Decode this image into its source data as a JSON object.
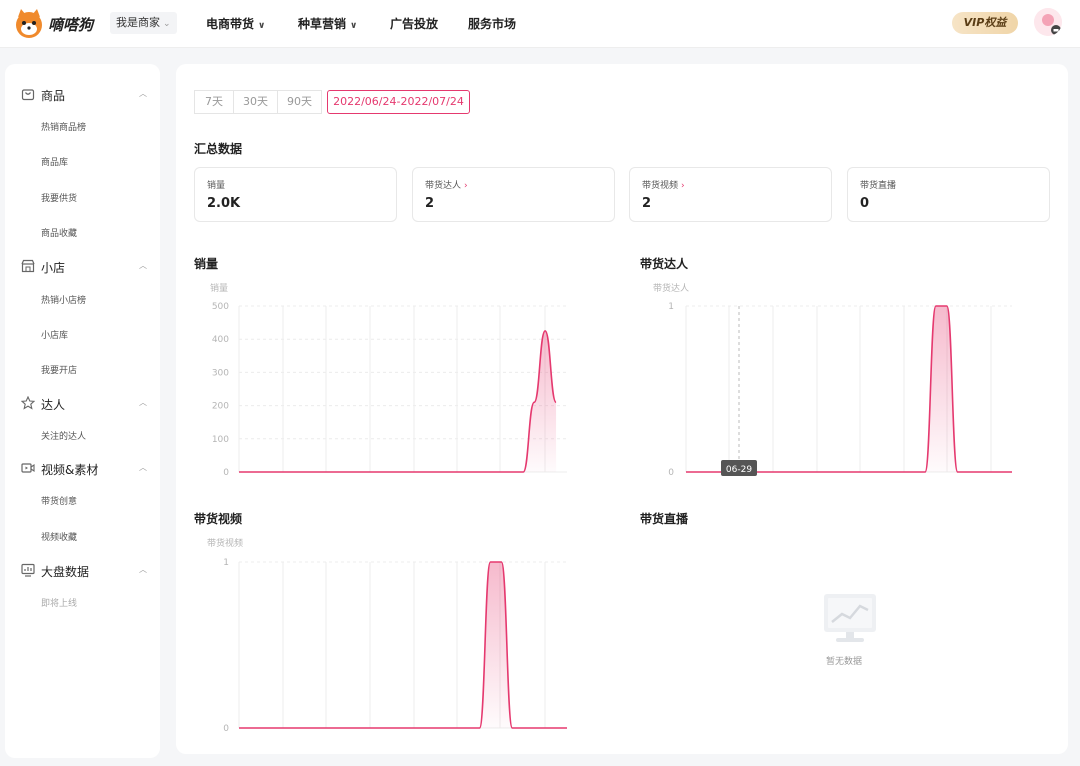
{
  "header": {
    "brand": "嘀嗒狗",
    "role_selector": "我是商家",
    "nav": [
      {
        "label": "电商带货",
        "has_dropdown": true
      },
      {
        "label": "种草营销",
        "has_dropdown": true
      },
      {
        "label": "广告投放",
        "has_dropdown": false
      },
      {
        "label": "服务市场",
        "has_dropdown": false
      }
    ],
    "vip_label": "VIP权益"
  },
  "sidebar": {
    "sections": [
      {
        "label": "商品",
        "icon": "bag-icon",
        "items": [
          "热销商品榜",
          "商品库",
          "我要供货",
          "商品收藏"
        ]
      },
      {
        "label": "小店",
        "icon": "shop-icon",
        "items": [
          "热销小店榜",
          "小店库",
          "我要开店"
        ]
      },
      {
        "label": "达人",
        "icon": "star-person-icon",
        "items": [
          "关注的达人"
        ]
      },
      {
        "label": "视频&素材",
        "icon": "video-icon",
        "items": [
          "带货创意",
          "视频收藏"
        ]
      },
      {
        "label": "大盘数据",
        "icon": "dashboard-icon",
        "items": [
          "即将上线"
        ]
      }
    ]
  },
  "date_tabs": [
    "7天",
    "30天",
    "90天",
    "2022/06/24-2022/07/24"
  ],
  "active_tab_index": 3,
  "summary": {
    "title": "汇总数据",
    "cards": [
      {
        "label": "销量",
        "value": "2.0K",
        "link": false
      },
      {
        "label": "带货达人",
        "value": "2",
        "link": true
      },
      {
        "label": "带货视频",
        "value": "2",
        "link": true
      },
      {
        "label": "带货直播",
        "value": "0",
        "link": false
      }
    ]
  },
  "accent_color": "#e5396f",
  "chart_data": [
    {
      "type": "area",
      "title": "销量",
      "ylabel": "销量",
      "yticks": [
        0,
        100,
        200,
        300,
        400,
        500
      ],
      "ylim": [
        0,
        500
      ],
      "x_days": 31,
      "points": [
        [
          0,
          0
        ],
        [
          26,
          0
        ],
        [
          27,
          210
        ],
        [
          28,
          425
        ],
        [
          29,
          210
        ]
      ],
      "grid": true
    },
    {
      "type": "area",
      "title": "带货达人",
      "ylabel": "带货达人",
      "yticks": [
        0,
        1
      ],
      "ylim": [
        0,
        1
      ],
      "x_days": 31,
      "points": [
        [
          0,
          0
        ],
        [
          22,
          0
        ],
        [
          23,
          1
        ],
        [
          24,
          1
        ],
        [
          25,
          0
        ],
        [
          30,
          0
        ]
      ],
      "tooltip": "06-29",
      "grid": true
    },
    {
      "type": "area",
      "title": "带货视频",
      "ylabel": "带货视频",
      "yticks": [
        0,
        1
      ],
      "ylim": [
        0,
        1
      ],
      "x_days": 31,
      "points": [
        [
          0,
          0
        ],
        [
          22,
          0
        ],
        [
          23,
          1
        ],
        [
          24,
          1
        ],
        [
          25,
          0
        ],
        [
          30,
          0
        ]
      ],
      "grid": true
    }
  ],
  "live_panel": {
    "title": "带货直播",
    "empty_text": "暂无数据"
  }
}
